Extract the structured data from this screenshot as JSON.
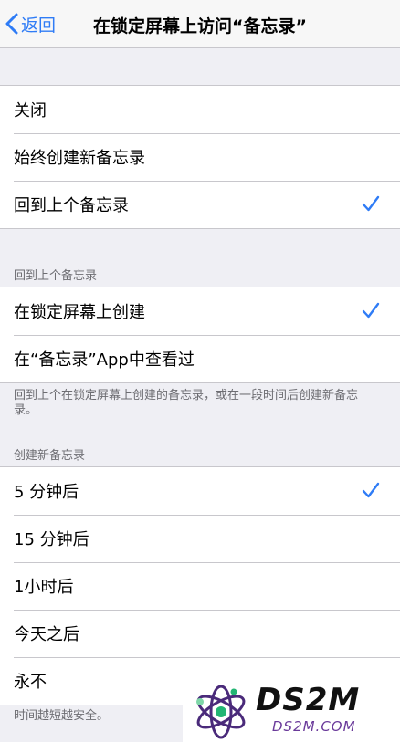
{
  "nav": {
    "back_label": "返回",
    "title": "在锁定屏幕上访问“备忘录”"
  },
  "group1": {
    "options": [
      {
        "label": "关闭",
        "selected": false
      },
      {
        "label": "始终创建新备忘录",
        "selected": false
      },
      {
        "label": "回到上个备忘录",
        "selected": true
      }
    ]
  },
  "group2": {
    "header": "回到上个备忘录",
    "options": [
      {
        "label": "在锁定屏幕上创建",
        "selected": true
      },
      {
        "label": "在“备忘录”App中查看过",
        "selected": false
      }
    ],
    "footer": "回到上个在锁定屏幕上创建的备忘录，或在一段时间后创建新备忘录。"
  },
  "group3": {
    "header": "创建新备忘录",
    "options": [
      {
        "label": "5 分钟后",
        "selected": true
      },
      {
        "label": "15 分钟后",
        "selected": false
      },
      {
        "label": "1小时后",
        "selected": false
      },
      {
        "label": "今天之后",
        "selected": false
      },
      {
        "label": "永不",
        "selected": false
      }
    ],
    "footer": "时间越短越安全。"
  },
  "watermark": {
    "brand": "DS2M",
    "domain": "DS2M.COM"
  },
  "colors": {
    "accent": "#2f7cf6",
    "background": "#efeff4",
    "separator": "#c8c7cc",
    "secondary_text": "#6d6d72"
  },
  "icons": {
    "back": "chevron-left-icon",
    "selected": "checkmark-icon"
  }
}
